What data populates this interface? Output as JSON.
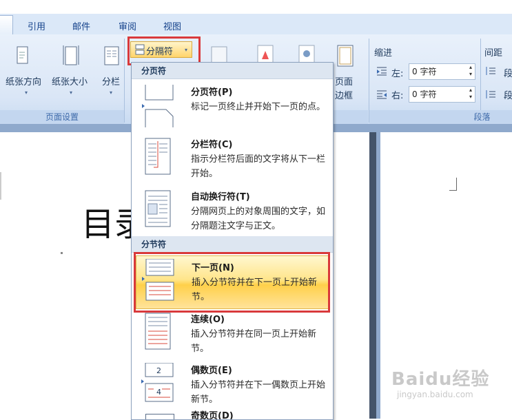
{
  "tabs": [
    {
      "label": "引用"
    },
    {
      "label": "邮件"
    },
    {
      "label": "审阅"
    },
    {
      "label": "视图"
    }
  ],
  "ribbon": {
    "orientation_label": "纸张方向",
    "size_label": "纸张大小",
    "columns_label": "分栏",
    "breaks_label": "分隔符",
    "page_border_label_1": "页面",
    "page_border_label_2": "边框",
    "page_setup_group": "页面设置",
    "indent_header": "缩进",
    "spacing_header": "间距",
    "indent_left_label": "左:",
    "indent_left_value": "0 字符",
    "indent_right_label": "右:",
    "indent_right_value": "0 字符",
    "spacing_before_label": "段",
    "spacing_after_label": "段",
    "paragraph_group": "段落"
  },
  "document": {
    "heading_visible": "目录"
  },
  "menu": {
    "section_page_breaks": "分页符",
    "section_section_breaks": "分节符",
    "items": [
      {
        "title": "分页符(P)",
        "desc": "标记一页终止并开始下一页的点。",
        "icon": "page-break-icon"
      },
      {
        "title": "分栏符(C)",
        "desc": "指示分栏符后面的文字将从下一栏开始。",
        "icon": "column-break-icon"
      },
      {
        "title": "自动换行符(T)",
        "desc": "分隔网页上的对象周围的文字，如分隔题注文字与正文。",
        "icon": "text-wrapping-icon"
      },
      {
        "title": "下一页(N)",
        "desc": "插入分节符并在下一页上开始新节。",
        "icon": "next-page-icon"
      },
      {
        "title": "连续(O)",
        "desc": "插入分节符并在同一页上开始新节。",
        "icon": "continuous-icon"
      },
      {
        "title": "偶数页(E)",
        "desc": "插入分节符并在下一偶数页上开始新节。",
        "icon": "even-page-icon"
      },
      {
        "title": "奇数页(D)",
        "desc": "",
        "icon": "odd-page-icon"
      }
    ]
  },
  "watermark": {
    "brand": "Baidu经验",
    "url": "jingyan.baidu.com"
  },
  "colors": {
    "highlight_box": "#d9393b",
    "menu_selected": "#ffd04a",
    "ribbon_bg": "#dae6f6"
  }
}
